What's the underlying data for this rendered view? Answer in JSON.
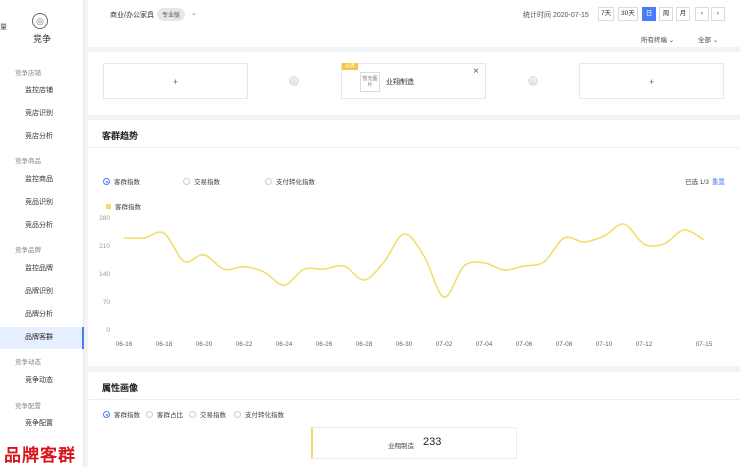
{
  "sidebar": {
    "edge_label": "量",
    "title": "竞争",
    "logo_glyph": "◎",
    "groups": [
      {
        "label": "竞争店铺",
        "items": [
          "监控店铺",
          "竞店识别",
          "竞店分析"
        ]
      },
      {
        "label": "竞争商品",
        "items": [
          "监控商品",
          "竞品识别",
          "竞品分析"
        ]
      },
      {
        "label": "竞争品牌",
        "items": [
          "监控品牌",
          "品牌识别",
          "品牌分析",
          "品牌客群"
        ]
      },
      {
        "label": "竞争动态",
        "items": [
          "竞争动态"
        ]
      },
      {
        "label": "竞争配置",
        "items": [
          "竞争配置"
        ]
      }
    ],
    "active_item": "品牌客群",
    "watermark": "品牌客群"
  },
  "topbar": {
    "category": "商业/办公家具",
    "badge": "专业版",
    "stat_time": "统计时间 2020-07-15",
    "ranges": [
      "7天",
      "30天",
      "日",
      "周",
      "月"
    ],
    "selected_range": "日",
    "prev_icon": "‹",
    "next_icon": "›",
    "filter_1": "所有终端",
    "filter_2": "全部"
  },
  "compare": {
    "add_glyph": "+",
    "vs_glyph": "VS",
    "shop_tag": "品牌",
    "shop_image_text": "暂无图片",
    "shop_name": "业翔制造",
    "close_glyph": "×"
  },
  "trend": {
    "title": "客群趋势",
    "metrics": [
      "客群指数",
      "交易指数",
      "支付转化指数"
    ],
    "selected_metric": "客群指数",
    "selected_count": "已选 1/3",
    "reset": "重置",
    "legend": "客群指数"
  },
  "attr": {
    "title": "属性画像",
    "metrics": [
      "客群指数",
      "客群占比",
      "交易指数",
      "支付转化指数"
    ],
    "selected_metric": "客群指数",
    "card_label": "业翔制造",
    "card_value": "233"
  },
  "chart_data": {
    "type": "line",
    "x": [
      "06-16",
      "06-17",
      "06-18",
      "06-19",
      "06-20",
      "06-21",
      "06-22",
      "06-23",
      "06-24",
      "06-25",
      "06-26",
      "06-27",
      "06-28",
      "06-29",
      "06-30",
      "07-01",
      "07-02",
      "07-03",
      "07-04",
      "07-05",
      "07-06",
      "07-07",
      "07-08",
      "07-09",
      "07-10",
      "07-11",
      "07-12",
      "07-13",
      "07-14",
      "07-15"
    ],
    "x_tick_labels": [
      "06-16",
      "06-18",
      "06-20",
      "06-22",
      "06-24",
      "06-26",
      "06-28",
      "06-30",
      "07-02",
      "07-04",
      "07-06",
      "07-08",
      "07-10",
      "07-12",
      "07-15"
    ],
    "series": [
      {
        "name": "客群指数",
        "color": "#f1df6b",
        "values": [
          230,
          230,
          242,
          172,
          188,
          152,
          158,
          145,
          112,
          152,
          152,
          160,
          125,
          170,
          240,
          185,
          82,
          160,
          168,
          150,
          160,
          170,
          230,
          220,
          235,
          265,
          215,
          215,
          250,
          225
        ]
      }
    ],
    "yticks": [
      0,
      70,
      140,
      210,
      280
    ],
    "ylim": [
      0,
      280
    ],
    "grid": false
  }
}
